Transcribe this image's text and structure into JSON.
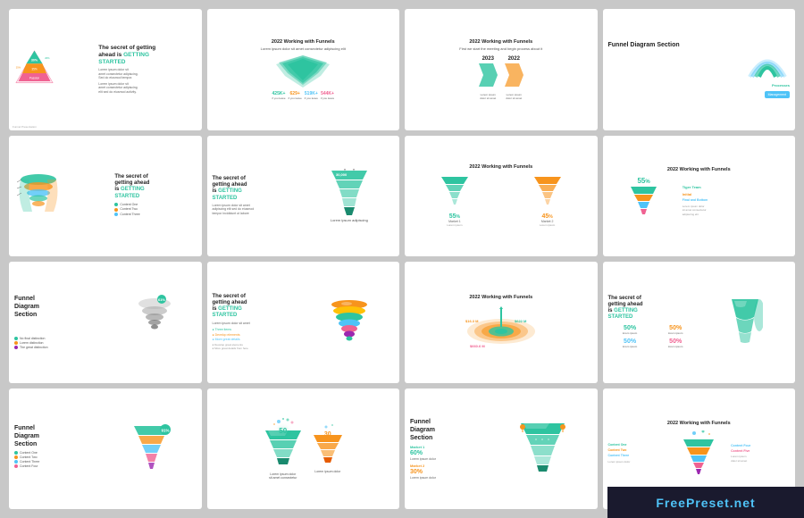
{
  "slides": [
    {
      "id": 1,
      "type": "pyramid-intro",
      "title": "The secret of getting ahead is GETTING STARTED",
      "subtitle_lines": [
        "Lorem ipsum dolor sit amet",
        "consectetur adipiscing elit"
      ],
      "accent_color": "#2ec4a0",
      "footer": "Funnel Presentation"
    },
    {
      "id": 2,
      "type": "funnel-2022",
      "title": "2022 Working with Funnels",
      "subtitle": "Lorem ipsum dolor sit amet consectetur adipiscing elit sed do eiusmod",
      "stats": [
        {
          "num": "425K+",
          "label": "if you leave"
        },
        {
          "num": "629+",
          "label": "if you leave"
        },
        {
          "num": "519K+",
          "label": "if you leave"
        },
        {
          "num": "544K+",
          "label": "if you leave"
        }
      ],
      "footer": "Funnel Presentation"
    },
    {
      "id": 3,
      "type": "compare-2022",
      "title": "2022 Working with Funnels",
      "subtitle": "First we start the meeting and begin process about it",
      "years": [
        "2023",
        "2022"
      ],
      "footer": "Funnel Presentation"
    },
    {
      "id": 4,
      "type": "diagram-section",
      "title": "Funnel Diagram Section",
      "items": [
        "Processes",
        "Management"
      ],
      "footer": "Funnel Presentation"
    },
    {
      "id": 5,
      "type": "getting-started-spiral",
      "title": "The secret of getting ahead is GETTING STARTED",
      "bullets": [
        {
          "label": "Content One",
          "color": "#2ec4a0"
        },
        {
          "label": "Content Two",
          "color": "#f7941d"
        },
        {
          "label": "Content Three",
          "color": "#4fc3f7"
        }
      ],
      "footer": "Funnel Presentation"
    },
    {
      "id": 6,
      "type": "getting-started-green-funnel",
      "title": "The secret of getting ahead is GETTING STARTED",
      "number": "30,000",
      "footer": "Funnel Presentation"
    },
    {
      "id": 7,
      "type": "funnel-percentages",
      "title": "2022 Working with Funnels",
      "items": [
        {
          "pct": "55%",
          "label": "Market 1"
        },
        {
          "pct": "45%",
          "label": "Market 2"
        }
      ],
      "footer": "Funnel Presentation"
    },
    {
      "id": 8,
      "type": "funnel-percents-right",
      "title": "2022 Working with Funnels",
      "pct": "55%",
      "labels": [
        "Tiger Team",
        "Initial",
        "Final and Bottom"
      ],
      "footer": "Funnel Presentation"
    },
    {
      "id": 9,
      "type": "diagram-section-2",
      "title": "Funnel Diagram Section",
      "percent": "61%",
      "bullets": [
        {
          "label": "No final distinction",
          "color": "#2ec4a0"
        },
        {
          "label": "Lorem distinction",
          "color": "#f7941d"
        },
        {
          "label": "the great distinction",
          "color": "#9c27b0"
        }
      ],
      "footer": "Funnel Presentation"
    },
    {
      "id": 10,
      "type": "getting-started-multicolor",
      "title": "The secret of getting ahead is GETTING STARTED",
      "items": [
        "Three items",
        "Develop elements",
        "More great details"
      ],
      "footer": "Funnel Presentation"
    },
    {
      "id": 11,
      "type": "funnel-orbit",
      "title": "2022 Working with Funnels",
      "stats": [
        "$16.3 M",
        "$622 M",
        "$660.6 M"
      ],
      "footer": "Funnel Presentation"
    },
    {
      "id": 12,
      "type": "getting-started-percents",
      "title": "The secret of getting ahead is GETTING STARTED",
      "percents": [
        "50%",
        "50%",
        "50%",
        "50%"
      ],
      "footer": "Funnel Presentation"
    },
    {
      "id": 13,
      "type": "funnel-section-bullets",
      "title": "Funnel Diagram Section",
      "percent": "91%",
      "bullets": [
        {
          "label": "Content One",
          "color": "#2ec4a0"
        },
        {
          "label": "Content Two",
          "color": "#f7941d"
        },
        {
          "label": "Content Three",
          "color": "#4fc3f7"
        },
        {
          "label": "Content Four",
          "color": "#f06292"
        }
      ],
      "footer": "Funnel Presentation"
    },
    {
      "id": 14,
      "type": "funnel-50-30",
      "title": "",
      "numbers": [
        "50",
        "30"
      ],
      "footer": "Funnel Presentation"
    },
    {
      "id": 15,
      "type": "funnel-diagram-markets",
      "title": "Funnel Diagram Section",
      "markets": [
        {
          "label": "Market 1",
          "pct": "60%"
        },
        {
          "label": "Market 2",
          "pct": "30%"
        }
      ],
      "footer": "Funnel Presentation"
    },
    {
      "id": 16,
      "type": "funnel-colorful-final",
      "title": "2022 Working with Funnels",
      "content_items": [
        "Content One",
        "Content Two",
        "Content Three",
        "Content Four",
        "Content Five"
      ],
      "footer": "Funnel Presentation"
    }
  ],
  "watermark": {
    "prefix": "Free",
    "highlight": "Preset",
    "suffix": ".net"
  }
}
